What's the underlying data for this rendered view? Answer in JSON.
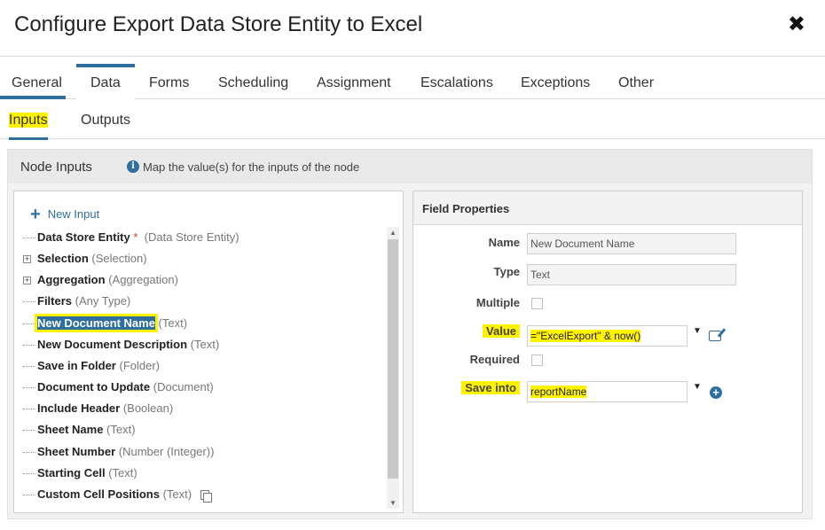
{
  "dialog": {
    "title": "Configure Export Data Store Entity to Excel",
    "close_glyph": "✖"
  },
  "tabs": [
    "General",
    "Data",
    "Forms",
    "Scheduling",
    "Assignment",
    "Escalations",
    "Exceptions",
    "Other"
  ],
  "active_tab": "Data",
  "subtabs": [
    "Inputs",
    "Outputs"
  ],
  "active_subtab": "Inputs",
  "node_inputs": {
    "title": "Node Inputs",
    "description": "Map the value(s) for the inputs of the node",
    "info_icon": "i",
    "new_input_label": "New Input",
    "items": [
      {
        "name": "Data Store Entity",
        "required": "*",
        "type": "(Data Store Entity)"
      },
      {
        "name": "Selection",
        "type": "(Selection)"
      },
      {
        "name": "Aggregation",
        "type": "(Aggregation)"
      },
      {
        "name": "Filters",
        "type": "(Any Type)"
      },
      {
        "name": "New Document Name",
        "type": "(Text)"
      },
      {
        "name": "New Document Description",
        "type": "(Text)"
      },
      {
        "name": "Save in Folder",
        "type": "(Folder)"
      },
      {
        "name": "Document to Update",
        "type": "(Document)"
      },
      {
        "name": "Include Header",
        "type": "(Boolean)"
      },
      {
        "name": "Sheet Name",
        "type": "(Text)"
      },
      {
        "name": "Sheet Number",
        "type": "(Number (Integer))"
      },
      {
        "name": "Starting Cell",
        "type": "(Text)"
      },
      {
        "name": "Custom Cell Positions",
        "type": "(Text)"
      }
    ],
    "selected_item": "New Document Name"
  },
  "field_properties": {
    "title": "Field Properties",
    "name_label": "Name",
    "name_value": "New Document Name",
    "type_label": "Type",
    "type_value": "Text",
    "multiple_label": "Multiple",
    "multiple_checked": false,
    "value_label": "Value",
    "value_value": "=\"ExcelExport\" & now()",
    "required_label": "Required",
    "required_checked": false,
    "save_into_label": "Save into",
    "save_into_value": "reportName"
  },
  "colors": {
    "accent": "#2f6f9f",
    "highlight": "#fff200",
    "required": "#d9352b"
  }
}
